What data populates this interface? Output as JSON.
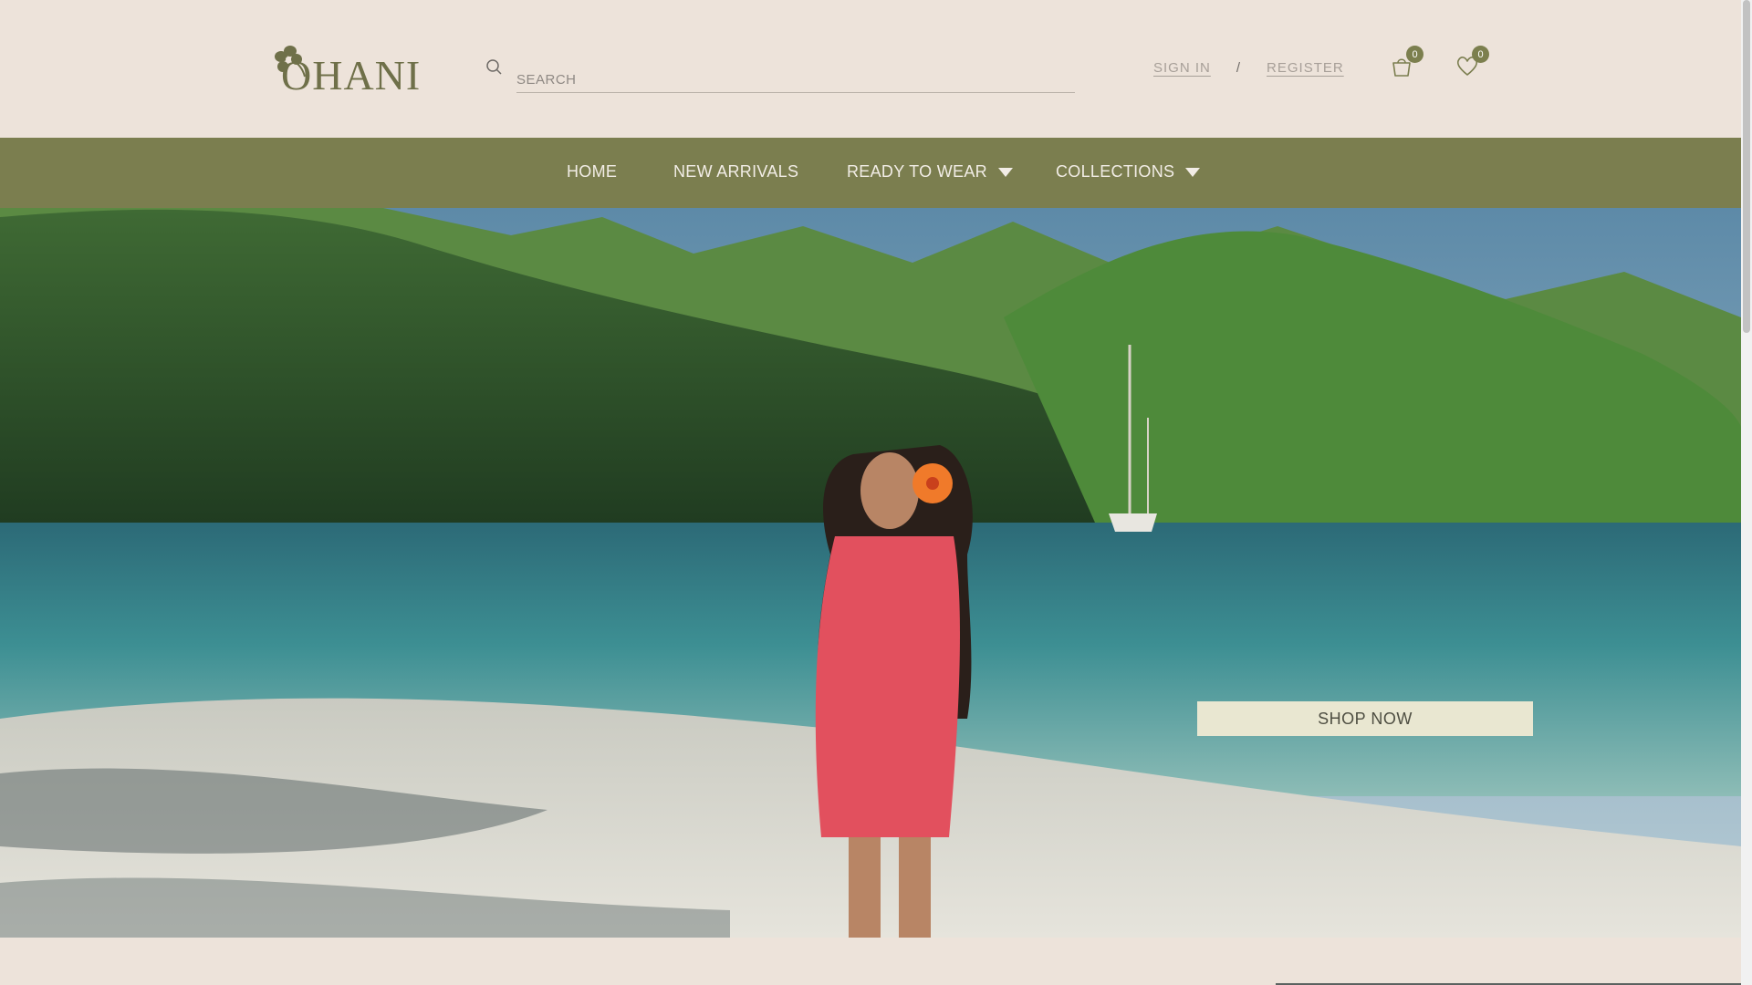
{
  "brand": {
    "logo_text": "OHANI",
    "logo_icon": "hibiscus-flower-icon",
    "color": "#6f7049"
  },
  "search": {
    "placeholder": "SEARCH",
    "icon": "search-icon"
  },
  "auth": {
    "sign_in": "SIGN IN",
    "separator": "/",
    "register": "REGISTER"
  },
  "cart": {
    "icon": "shopping-bag-icon",
    "count": "0"
  },
  "wishlist": {
    "icon": "heart-icon",
    "count": "0"
  },
  "nav": {
    "background": "#7b7e4f",
    "items": [
      {
        "label": "HOME",
        "has_dropdown": false
      },
      {
        "label": "NEW ARRIVALS",
        "has_dropdown": false
      },
      {
        "label": "READY TO WEAR",
        "has_dropdown": true
      },
      {
        "label": "COLLECTIONS",
        "has_dropdown": true
      }
    ]
  },
  "hero": {
    "cta_label": "SHOP NOW",
    "cta_background": "#e9e7d1"
  },
  "colors": {
    "page_background": "#ede3da",
    "badge": "#7c7f4e"
  }
}
